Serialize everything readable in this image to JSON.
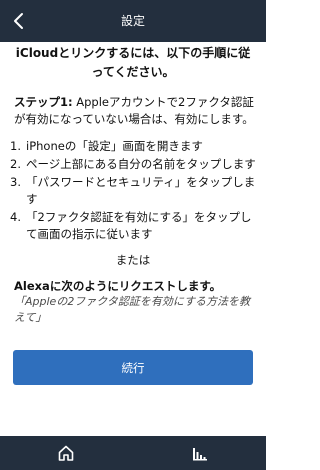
{
  "header": {
    "title": "設定",
    "back_icon": "chevron-left-icon"
  },
  "content": {
    "intro": "iCloudとリンクするには、以下の手順に従ってください。",
    "step_label": "ステップ1:",
    "step_text": " Appleアカウントで2ファクタ認証が有効になっていない場合は、有効にします。",
    "list": [
      {
        "num": "1.",
        "text": "iPhoneの「設定」画面を開きます"
      },
      {
        "num": "2.",
        "text": "ページ上部にある自分の名前をタップします"
      },
      {
        "num": "3.",
        "text": "「パスワードとセキュリティ」をタップします"
      },
      {
        "num": "4.",
        "text": "「2ファクタ認証を有効にする」をタップして画面の指示に従います"
      }
    ],
    "or": "または",
    "request": "Alexaに次のようにリクエストします。",
    "example": "「Appleの2ファクタ認証を有効にする方法を教えて」",
    "continue_label": "続行"
  },
  "tabbar": {
    "home_icon": "home-icon",
    "activity_icon": "activity-bars-icon"
  },
  "colors": {
    "header_bg": "#232f3e",
    "button_bg": "#2f6fbd"
  }
}
